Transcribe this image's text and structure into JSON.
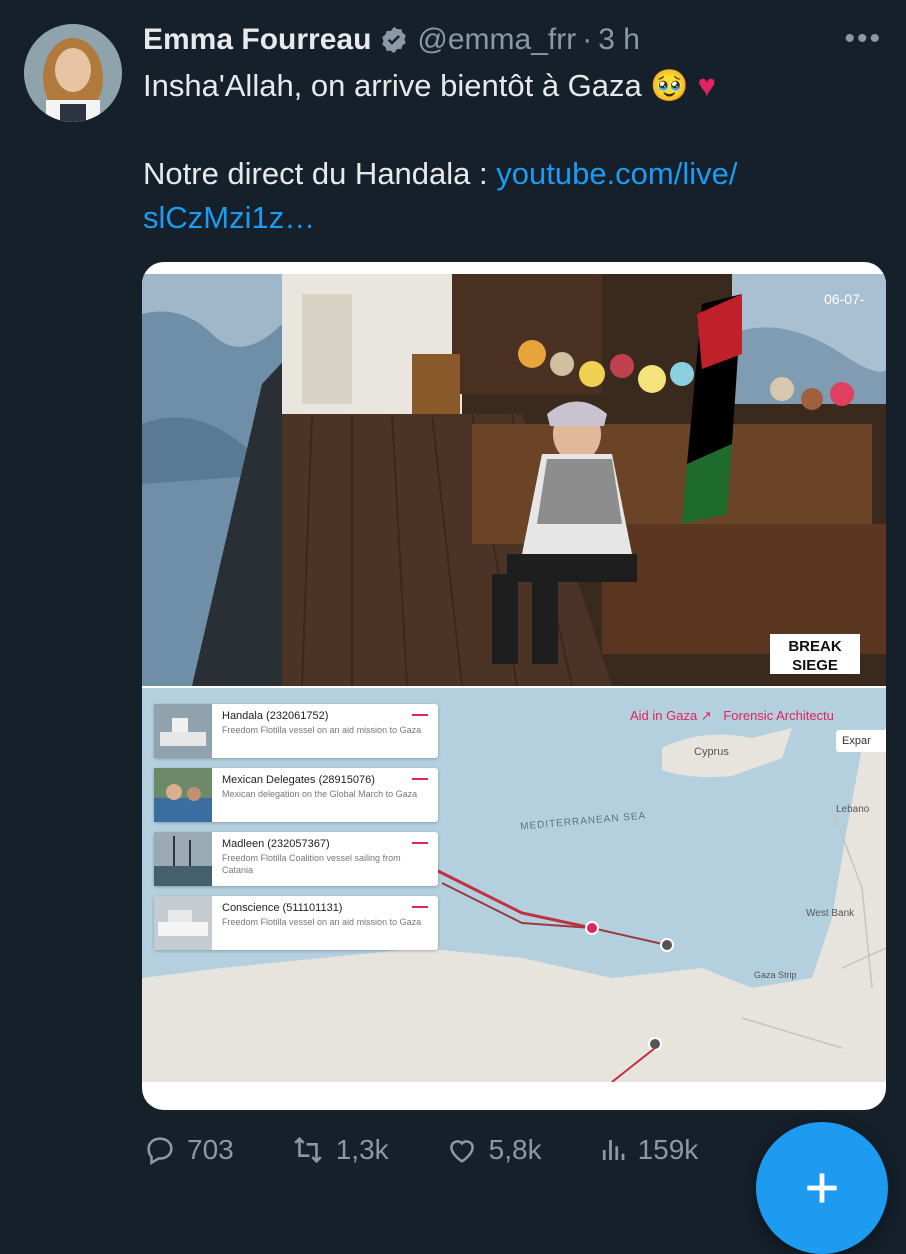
{
  "author": {
    "name": "Emma Fourreau",
    "handle": "@emma_frr",
    "separator": "·",
    "time": "3 h"
  },
  "tweet": {
    "line1": "Insha'Allah, on arrive bientôt à Gaza",
    "line1_emoji": "🥹",
    "line1_heart": "♥",
    "line2_prefix": "Notre direct du Handala : ",
    "link_part1": "youtube.com/live/",
    "link_part2": "slCzMzi1z…"
  },
  "media": {
    "video_timestamp": "06-07-",
    "watermark_line1": "BREAK",
    "watermark_line2": "SIEGE",
    "map": {
      "links": [
        "Aid in Gaza ↗",
        "Forensic Architectu"
      ],
      "expand_button": "Expar",
      "labels": [
        "Cyprus",
        "MEDITERRANEAN SEA",
        "Lebano",
        "West Bank",
        "Gaza Strip"
      ],
      "vessels": [
        {
          "title": "Handala (232061752)",
          "desc": "Freedom Flotilla vessel on an aid mission to Gaza"
        },
        {
          "title": "Mexican Delegates (28915076)",
          "desc": "Mexican delegation on the Global March to Gaza"
        },
        {
          "title": "Madleen (232057367)",
          "desc": "Freedom Flotilla Coalition vessel sailing from Catania"
        },
        {
          "title": "Conscience (511101131)",
          "desc": "Freedom Flotilla vessel on an aid mission to Gaza"
        }
      ]
    }
  },
  "actions": {
    "replies": "703",
    "retweets": "1,3k",
    "likes": "5,8k",
    "views": "159k"
  },
  "colors": {
    "background": "#15202b",
    "accent": "#1d9bf0",
    "muted": "#8b98a5",
    "route": "#e0245e"
  }
}
